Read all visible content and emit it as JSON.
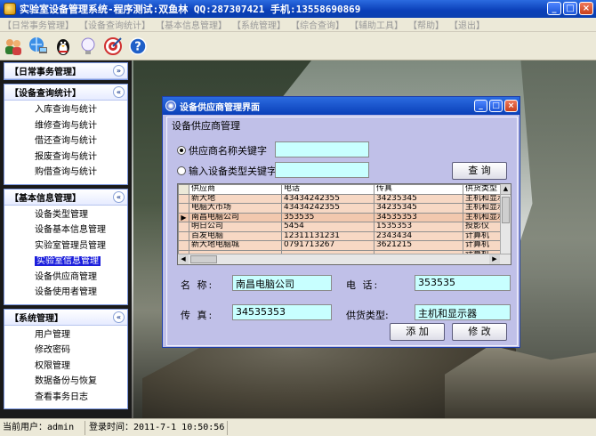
{
  "window": {
    "title": "实验室设备管理系统-程序测试:双鱼林 QQ:287307421 手机:13558690869",
    "controls": [
      "_",
      "□",
      "×"
    ]
  },
  "menu": [
    "【日常事务管理】",
    "【设备查询统计】",
    "【基本信息管理】",
    "【系统管理】",
    "【综合查询】",
    "【辅助工具】",
    "【帮助】",
    "【退出】"
  ],
  "toolbar": [
    "users-icon",
    "network-icon",
    "penguin-icon",
    "lightbulb-icon",
    "target-icon",
    "help-icon"
  ],
  "sidebar": {
    "panels": [
      {
        "title": "【日常事务管理】",
        "toggle": "»",
        "items": []
      },
      {
        "title": "【设备查询统计】",
        "toggle": "«",
        "items": [
          "入库查询与统计",
          "维修查询与统计",
          "借还查询与统计",
          "报废查询与统计",
          "购借查询与统计"
        ]
      },
      {
        "title": "【基本信息管理】",
        "toggle": "«",
        "items": [
          "设备类型管理",
          "设备基本信息管理",
          "实验室管理员管理",
          "实验室信息管理",
          "设备供应商管理",
          "设备使用者管理"
        ],
        "active": 3
      },
      {
        "title": "【系统管理】",
        "toggle": "«",
        "items": [
          "用户管理",
          "修改密码",
          "权限管理",
          "数据备份与恢复",
          "查看事务日志"
        ]
      }
    ]
  },
  "status": {
    "user": "当前用户：admin",
    "login": "登录时间：2011-7-1  10:50:56"
  },
  "dialog": {
    "title": "设备供应商管理界面",
    "group_label": "设备供应商管理",
    "radio_name_label": "供应商名称关键字",
    "radio_type_label": "输入设备类型关键字",
    "name_keyword": "",
    "type_keyword": "",
    "search_button": "查  询",
    "grid": {
      "columns": [
        "供应商",
        "电话",
        "传真",
        "供货类型"
      ],
      "rows": [
        [
          "新大地",
          "43434242355",
          "34235345",
          "主机和显示"
        ],
        [
          "电脑大市场",
          "43434242355",
          "34235345",
          "主机和显示"
        ],
        [
          "南昌电脑公司",
          "353535",
          "34535353",
          "主机和显示"
        ],
        [
          "明日公司",
          "5454",
          "1535353",
          "投影仪"
        ],
        [
          "百发电脑",
          "12311131231",
          "2343434",
          "计算机"
        ],
        [
          "新大地电脑城",
          "0791713267",
          "3621215",
          "计算机"
        ],
        [
          "",
          "",
          "",
          "计算机"
        ]
      ],
      "selected_row": 2,
      "current_marker": "▶"
    },
    "form": {
      "name_label": "名  称:",
      "name_value": "南昌电脑公司",
      "phone_label": "电  话:",
      "phone_value": "353535",
      "fax_label": "传  真:",
      "fax_value": "34535353",
      "type_label": "供货类型:",
      "type_value": "主机和显示器"
    },
    "add_button": "添  加",
    "modify_button": "修  改"
  }
}
